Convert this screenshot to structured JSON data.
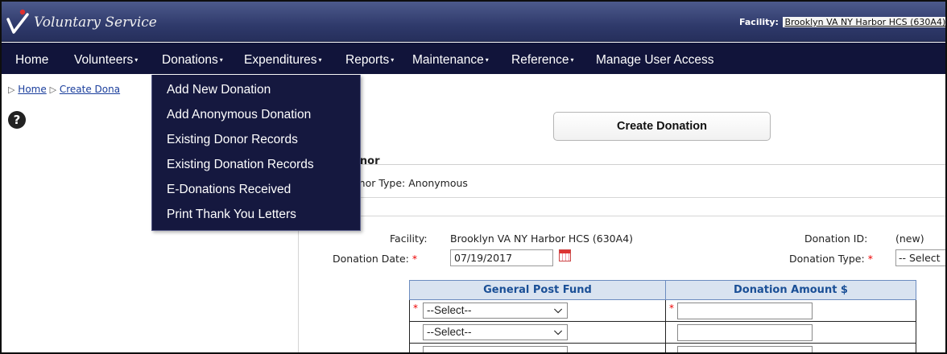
{
  "app": {
    "title": "Voluntary Service"
  },
  "header": {
    "facility_label": "Facility:",
    "facility_value": "Brooklyn VA NY Harbor HCS (630A4)"
  },
  "nav": {
    "items": [
      {
        "label": "Home",
        "has_caret": false
      },
      {
        "label": "Volunteers",
        "has_caret": true
      },
      {
        "label": "Donations",
        "has_caret": true
      },
      {
        "label": "Expenditures",
        "has_caret": true
      },
      {
        "label": "Reports",
        "has_caret": true
      },
      {
        "label": "Maintenance",
        "has_caret": true
      },
      {
        "label": "Reference",
        "has_caret": true
      },
      {
        "label": "Manage User Access",
        "has_caret": false
      }
    ],
    "caret": "▾"
  },
  "donations_menu": {
    "items": [
      "Add New Donation",
      "Add Anonymous Donation",
      "Existing Donor Records",
      "Existing Donation Records",
      "E-Donations Received",
      "Print Thank You Letters"
    ]
  },
  "breadcrumb": {
    "home": "Home",
    "current": "Create Dona"
  },
  "help": {
    "glyph": "?"
  },
  "main": {
    "create_button": "Create Donation",
    "donor_heading": "onor",
    "donor_type": "onor Type: Anonymous",
    "facility_label": "Facility:",
    "facility_value": "Brooklyn VA NY Harbor HCS (630A4)",
    "donation_id_label": "Donation ID:",
    "donation_id_value": "(new)",
    "donation_date_label": "Donation Date:",
    "donation_date_value": "07/19/2017",
    "donation_type_label": "Donation Type:",
    "donation_type_value": "-- Select",
    "required_mark": "*"
  },
  "fund_table": {
    "headers": [
      "General Post Fund",
      "Donation Amount $"
    ],
    "select_placeholder": "--Select--"
  },
  "colors": {
    "nav_bg": "#11143a",
    "title_bg": "#2f3a6b",
    "link": "#1a3e9c",
    "table_header_text": "#1a4f96",
    "required": "#e00000"
  }
}
